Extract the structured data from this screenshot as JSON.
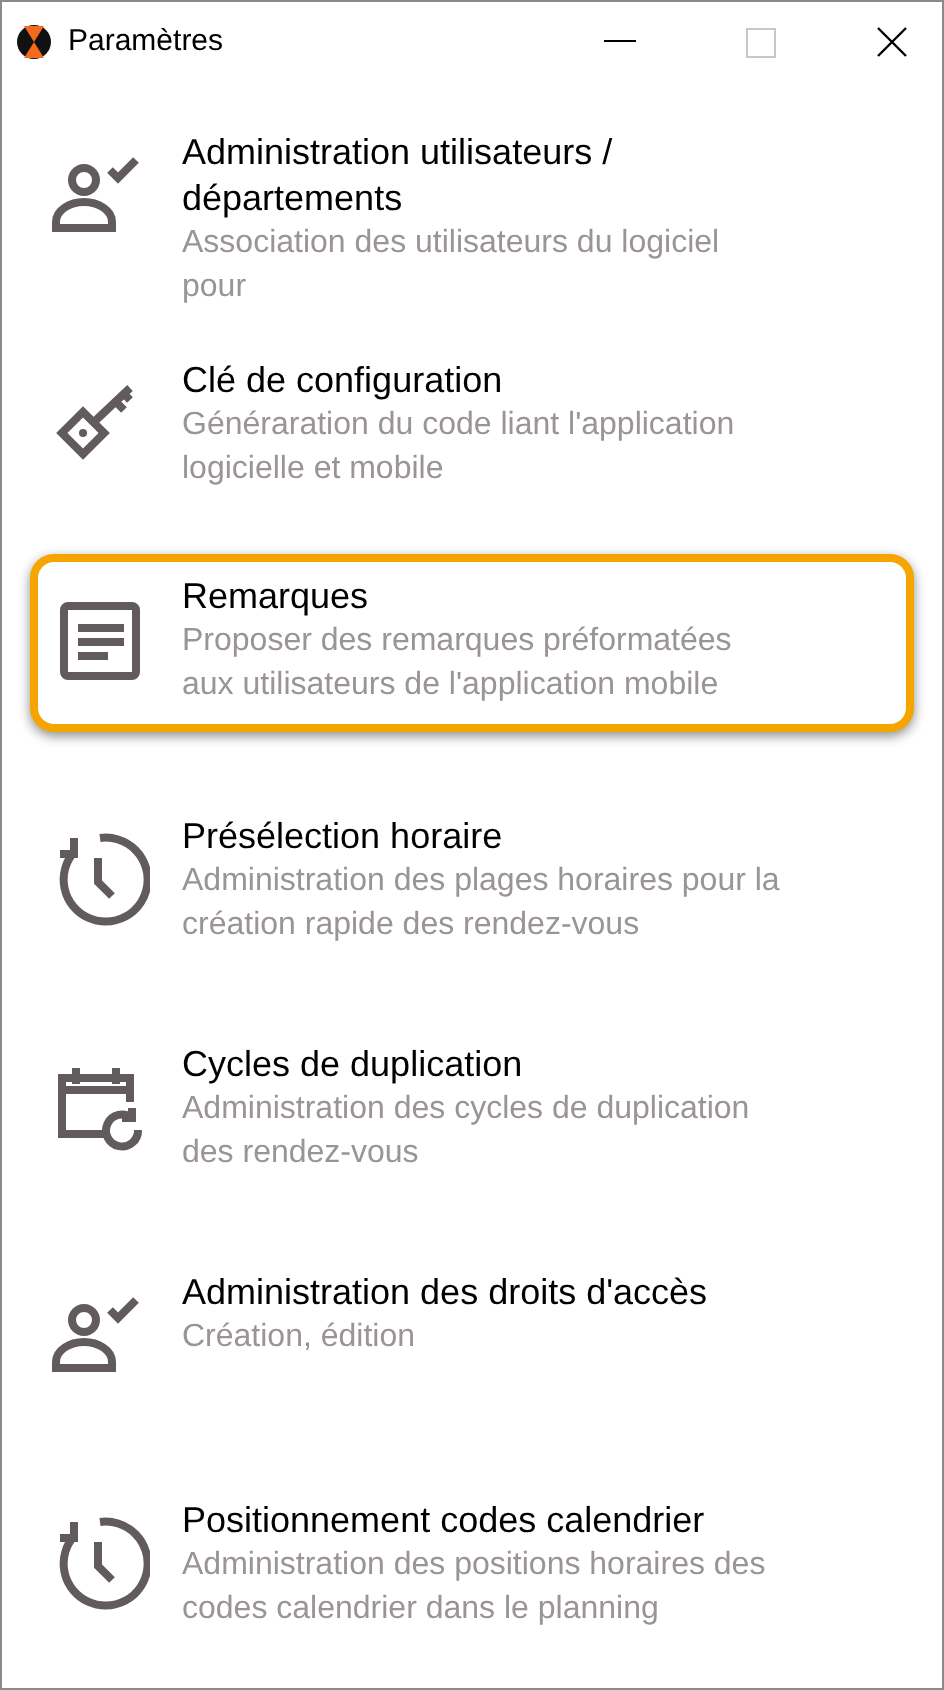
{
  "window": {
    "title": "Paramètres"
  },
  "items": [
    {
      "kind": "user-check",
      "title": "Administration utilisateurs / départements",
      "description": "Association des utilisateurs du logiciel pour",
      "selected": false
    },
    {
      "kind": "key",
      "title": "Clé de configuration",
      "description": "Généraration du code liant l'application logicielle et mobile",
      "selected": false
    },
    {
      "kind": "notes",
      "title": "Remarques",
      "description": "Proposer des remarques préformatées aux utilisateurs de l'application mobile",
      "selected": true
    },
    {
      "kind": "clock",
      "title": "Présélection horaire",
      "description": "Administration des plages horaires pour la création rapide des rendez-vous",
      "selected": false
    },
    {
      "kind": "calendar-sync",
      "title": "Cycles de duplication",
      "description": "Administration des cycles de duplication des rendez-vous",
      "selected": false
    },
    {
      "kind": "user-check",
      "title": "Administration des droits d'accès",
      "description": "Création, édition",
      "selected": false
    },
    {
      "kind": "clock",
      "title": "Positionnement codes calendrier",
      "description": "Administration des positions horaires des codes calendrier dans le planning",
      "selected": false
    }
  ]
}
